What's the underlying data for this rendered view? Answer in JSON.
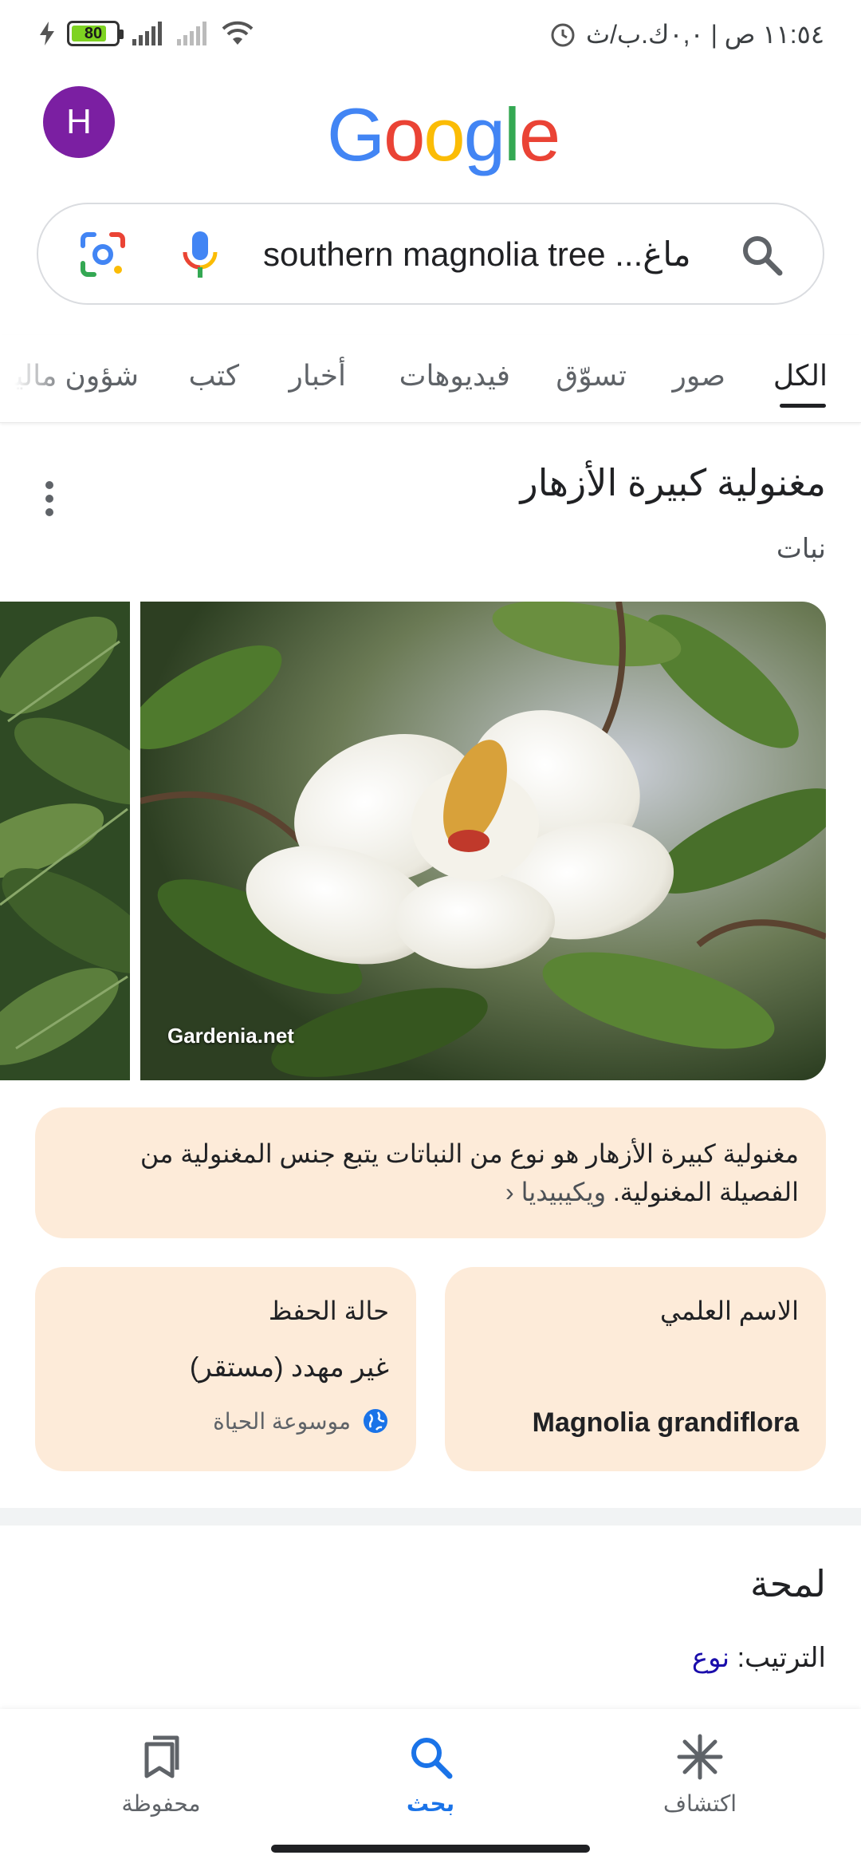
{
  "status_bar": {
    "battery_level": 80,
    "battery_text": "80",
    "time_text": "١١:٥٤ ص | ٠,٠ك.ب/ث",
    "icons": [
      "charging-icon",
      "battery-icon",
      "signal-icon",
      "signal-icon",
      "wifi-icon",
      "alarm-icon"
    ]
  },
  "header": {
    "avatar_letter": "H",
    "logo_letters": [
      {
        "char": "G",
        "color": "#4285F4"
      },
      {
        "char": "o",
        "color": "#EA4335"
      },
      {
        "char": "o",
        "color": "#FBBC05"
      },
      {
        "char": "g",
        "color": "#4285F4"
      },
      {
        "char": "l",
        "color": "#34A853"
      },
      {
        "char": "e",
        "color": "#EA4335"
      }
    ]
  },
  "search": {
    "query": "southern magnolia tree ...ماغ",
    "icons": [
      "google-lens-icon",
      "microphone-icon",
      "search-icon"
    ]
  },
  "tabs": [
    {
      "label": "الكل",
      "active": true
    },
    {
      "label": "صور"
    },
    {
      "label": "تسوّق"
    },
    {
      "label": "فيديوهات"
    },
    {
      "label": "أخبار"
    },
    {
      "label": "كتب"
    },
    {
      "label": "شؤون مالية"
    }
  ],
  "knowledge_panel": {
    "title": "مغنولية كبيرة الأزهار",
    "subtitle": "نبات",
    "image_credit": "Gardenia.net",
    "description": "مغنولية كبيرة الأزهار هو نوع من النباتات يتبع جنس المغنولية من الفصيلة المغنولية.",
    "description_source": "ويكيبيديا",
    "facts": {
      "scientific_name_label": "الاسم العلمي",
      "scientific_name_value": "Magnolia grandiflora",
      "conservation_label": "حالة الحفظ",
      "conservation_value": "غير مهدد (مستقر)",
      "conservation_source": "موسوعة الحياة"
    }
  },
  "overview": {
    "title": "لمحة",
    "order_label": "الترتيب:",
    "order_value": "نوع"
  },
  "bottom_nav": [
    {
      "label": "اكتشاف",
      "icon": "asterisk-icon"
    },
    {
      "label": "بحث",
      "icon": "search-icon",
      "active": true
    },
    {
      "label": "محفوظة",
      "icon": "bookmarks-icon"
    }
  ],
  "colors": {
    "accent_blue": "#1a73e8",
    "card_bg": "#fdebd9",
    "avatar_bg": "#7b1fa2",
    "link": "#1a0dab"
  }
}
